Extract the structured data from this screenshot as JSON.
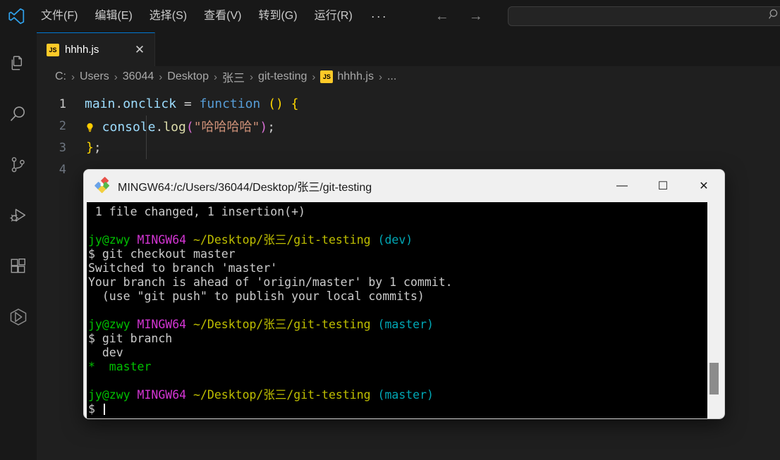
{
  "app": {
    "logo_icon": "vscode-logo-icon",
    "menu": [
      {
        "label": "文件(F)",
        "name": "menu-file"
      },
      {
        "label": "编辑(E)",
        "name": "menu-edit"
      },
      {
        "label": "选择(S)",
        "name": "menu-selection"
      },
      {
        "label": "查看(V)",
        "name": "menu-view"
      },
      {
        "label": "转到(G)",
        "name": "menu-go"
      },
      {
        "label": "运行(R)",
        "name": "menu-run"
      }
    ],
    "menu_more": "···",
    "nav_back": "←",
    "nav_forward": "→",
    "command_center": {
      "value": "",
      "placeholder": "",
      "icon": "search-icon"
    }
  },
  "activitybar": {
    "items": [
      {
        "name": "explorer",
        "icon": "files-icon",
        "label": "资源管理器"
      },
      {
        "name": "search",
        "icon": "search-icon",
        "label": "搜索"
      },
      {
        "name": "source-control",
        "icon": "source-control-icon",
        "label": "源代码管理"
      },
      {
        "name": "run-debug",
        "icon": "run-and-debug-icon",
        "label": "运行和调试"
      },
      {
        "name": "extensions",
        "icon": "extensions-icon",
        "label": "扩展"
      },
      {
        "name": "remote",
        "icon": "cube-icon",
        "label": "远程资源管理器"
      }
    ]
  },
  "editor": {
    "tab": {
      "label": "hhhh.js",
      "badge": "JS",
      "close": "✕"
    },
    "breadcrumb": [
      "C:",
      "Users",
      "36044",
      "Desktop",
      "张三",
      "git-testing",
      "hhhh.js",
      "..."
    ],
    "breadcrumb_separator": "›",
    "breadcrumb_file_badge": "JS",
    "code": {
      "lines": [
        {
          "num": "1",
          "text": "main.onclick = function () {"
        },
        {
          "num": "2",
          "text": "  console.log(\"哈哈哈哈\");"
        },
        {
          "num": "3",
          "text": "  };"
        },
        {
          "num": "4",
          "text": ""
        }
      ],
      "tokens": {
        "l1_a": "main",
        "l1_b": ".",
        "l1_c": "onclick",
        "l1_d": " = ",
        "l1_e": "function",
        "l1_f": " (",
        "l1_g": ") ",
        "l1_h": "{",
        "l2_bulb": "💡",
        "l2_a": "console",
        "l2_b": ".",
        "l2_c": "log",
        "l2_d": "(",
        "l2_e": "\"哈哈哈哈\"",
        "l2_f": ")",
        "l2_g": ";",
        "l3_a": "}",
        "l3_b": ";"
      }
    }
  },
  "terminal": {
    "title": "MINGW64:/c/Users/36044/Desktop/张三/git-testing",
    "icon": "git-bash-icon",
    "window_controls": {
      "minimize": "—",
      "maximize": "☐",
      "close": "✕"
    },
    "lines": [
      {
        "type": "plain",
        "text": " 1 file changed, 1 insertion(+)"
      },
      {
        "type": "blank",
        "text": ""
      },
      {
        "type": "prompt",
        "user": "jy@zwy",
        "shell": "MINGW64",
        "path": "~/Desktop/张三/git-testing",
        "branch": "(dev)"
      },
      {
        "type": "command",
        "text": "$ git checkout master"
      },
      {
        "type": "plain",
        "text": "Switched to branch 'master'"
      },
      {
        "type": "plain",
        "text": "Your branch is ahead of 'origin/master' by 1 commit."
      },
      {
        "type": "plain",
        "text": "  (use \"git push\" to publish your local commits)"
      },
      {
        "type": "blank",
        "text": ""
      },
      {
        "type": "prompt",
        "user": "jy@zwy",
        "shell": "MINGW64",
        "path": "~/Desktop/张三/git-testing",
        "branch": "(master)"
      },
      {
        "type": "command",
        "text": "$ git branch"
      },
      {
        "type": "plain",
        "text": "  dev"
      },
      {
        "type": "branch-current",
        "marker": "*",
        "name": "  master"
      },
      {
        "type": "blank",
        "text": ""
      },
      {
        "type": "prompt",
        "user": "jy@zwy",
        "shell": "MINGW64",
        "path": "~/Desktop/张三/git-testing",
        "branch": "(master)"
      },
      {
        "type": "command-cursor",
        "text": "$ "
      }
    ],
    "scrollbar": {
      "name": "terminal-scrollbar"
    }
  },
  "colors": {
    "accent": "#0078d4",
    "js_badge": "#ffca28",
    "term_green": "#00c000",
    "term_magenta": "#d335d3",
    "term_yellow": "#bfbf00",
    "term_cyan": "#00a7b5",
    "editor_bg": "#1f1f1f",
    "chrome_bg": "#181818"
  }
}
